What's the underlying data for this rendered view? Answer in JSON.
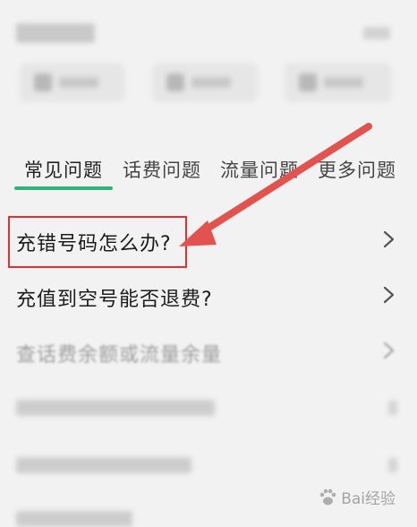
{
  "tabs": [
    {
      "label": "常见问题",
      "active": true
    },
    {
      "label": "话费问题",
      "active": false
    },
    {
      "label": "流量问题",
      "active": false
    },
    {
      "label": "更多问题",
      "active": false
    }
  ],
  "faq": [
    {
      "label": "充错号码怎么办?"
    },
    {
      "label": "充值到空号能否退费?"
    },
    {
      "label": "查话费余额或流量余量"
    }
  ],
  "colors": {
    "accent": "#2fb57c",
    "annotation_red": "#e03030",
    "arrow": "#e2524e"
  },
  "watermark": {
    "text": "Bai经验"
  }
}
